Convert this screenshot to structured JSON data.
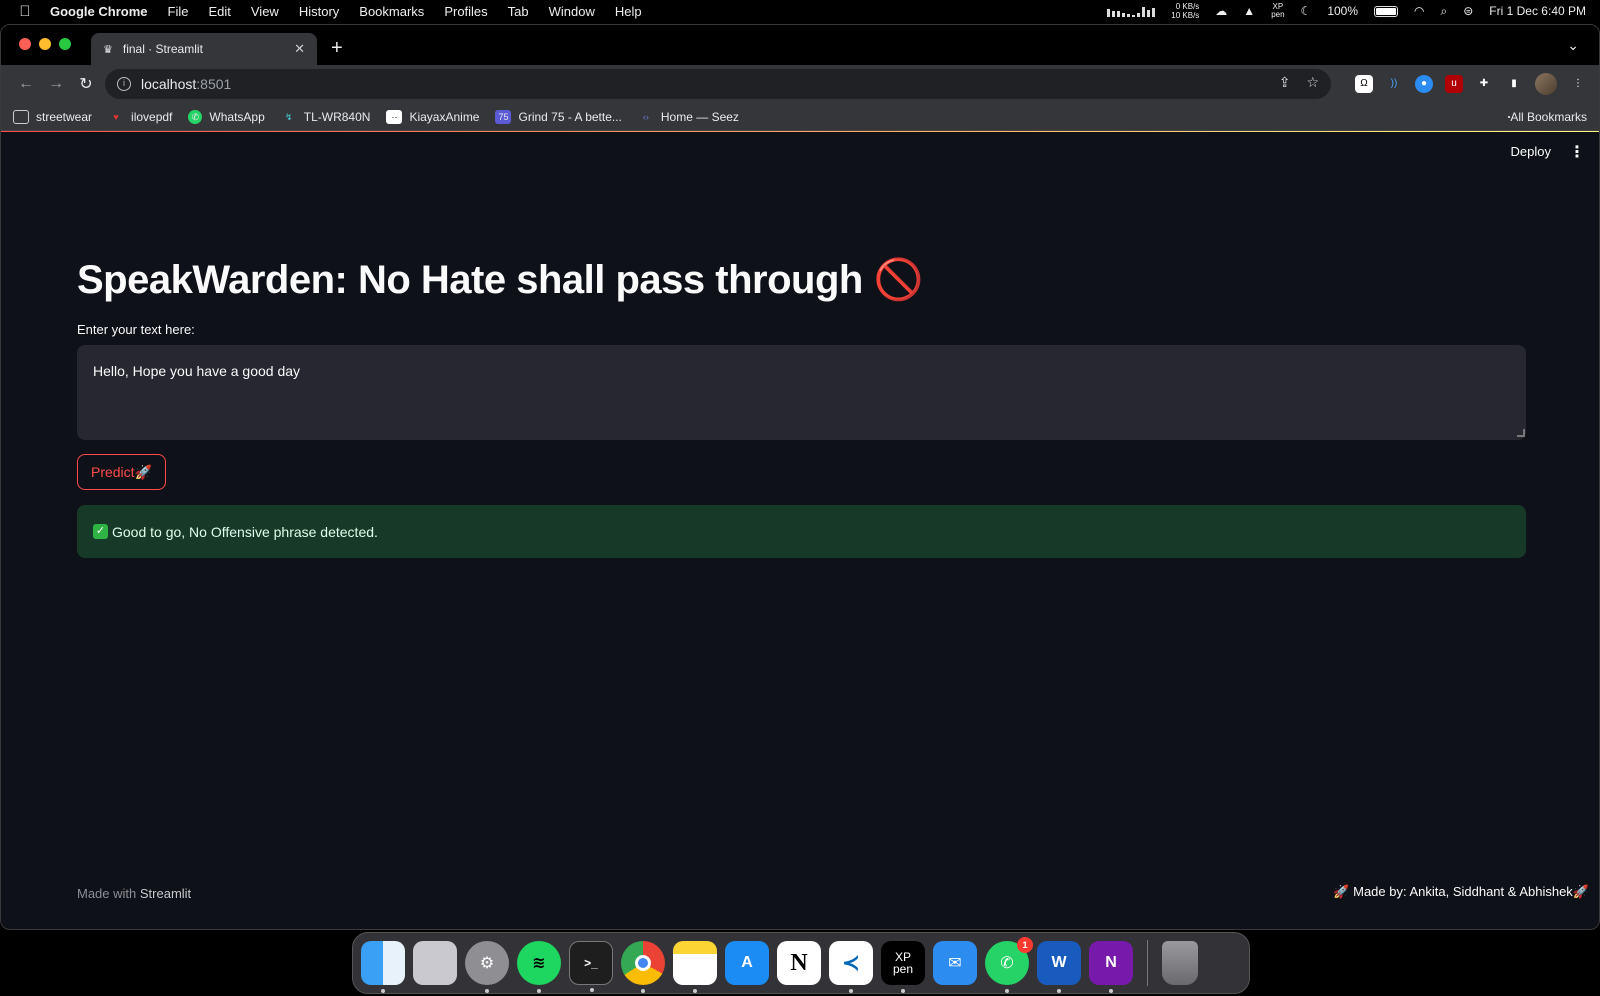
{
  "menubar": {
    "app_name": "Google Chrome",
    "items": [
      "File",
      "Edit",
      "View",
      "History",
      "Bookmarks",
      "Profiles",
      "Tab",
      "Window",
      "Help"
    ],
    "net_up": "0 KB/s",
    "net_down": "10 KB/s",
    "battery": "100%",
    "datetime": "Fri 1 Dec  6:40 PM"
  },
  "browser": {
    "tab_title": "final · Streamlit",
    "url_host": "localhost",
    "url_port": ":8501",
    "bookmarks": [
      "streetwear",
      "ilovepdf",
      "WhatsApp",
      "TL-WR840N",
      "KiayaxAnime",
      "Grind 75 - A bette...",
      "Home — Seez"
    ],
    "all_bookmarks": "All Bookmarks"
  },
  "app": {
    "deploy": "Deploy",
    "title": "SpeakWarden: No Hate shall pass through 🚫",
    "input_label": "Enter your text here:",
    "input_value": "Hello, Hope you have a good day",
    "predict_label": "Predict🚀",
    "result": "Good to go, No Offensive phrase detected.",
    "footer_prefix": "Made with",
    "footer_brand": "Streamlit",
    "credits": "🚀 Made by: Ankita, Siddhant & Abhishek🚀"
  },
  "dock": {
    "whatsapp_badge": "1"
  }
}
